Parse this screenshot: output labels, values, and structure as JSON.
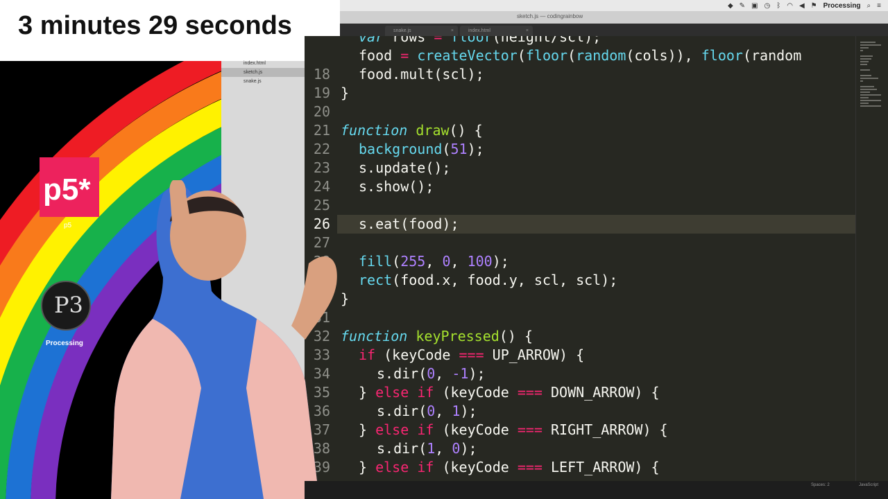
{
  "overlay": {
    "timer_text": "3 minutes 29 seconds"
  },
  "desktop": {
    "p5_logo_text": "p5*",
    "p5_label": "p5",
    "processing_logo_text": "P3",
    "processing_label": "Processing",
    "rainbow_colors": [
      "#ee1c24",
      "#f97a1b",
      "#fff200",
      "#17b14b",
      "#1d72d4",
      "#7a2fbf"
    ]
  },
  "menubar": {
    "app_name": "Processing",
    "icons": [
      "dropbox-icon",
      "evernote-icon",
      "screen-icon",
      "time-machine-icon",
      "bluetooth-icon",
      "wifi-icon",
      "volume-icon",
      "flag-icon"
    ]
  },
  "window": {
    "title": "sketch.js — codingrainbow"
  },
  "sidebar": {
    "files": [
      {
        "name": "index.html",
        "active": false
      },
      {
        "name": "sketch.js",
        "active": true
      },
      {
        "name": "snake.js",
        "active": false
      }
    ]
  },
  "tabs": [
    {
      "label": "snake.js"
    },
    {
      "label": "index.html"
    }
  ],
  "editor": {
    "active_line": "26",
    "lines": [
      {
        "n": "",
        "code": "var rows = floor(height/scl);"
      },
      {
        "n": "",
        "code": "food = createVector(floor(random(cols)), floor(random"
      },
      {
        "n": "18",
        "code": "food.mult(scl);"
      },
      {
        "n": "19",
        "code": "}"
      },
      {
        "n": "20",
        "code": ""
      },
      {
        "n": "21",
        "code": "function draw() {"
      },
      {
        "n": "22",
        "code": "background(51);"
      },
      {
        "n": "23",
        "code": "s.update();"
      },
      {
        "n": "24",
        "code": "s.show();"
      },
      {
        "n": "25",
        "code": ""
      },
      {
        "n": "26",
        "code": "s.eat(food);"
      },
      {
        "n": "27",
        "code": ""
      },
      {
        "n": "28",
        "code": "fill(255, 0, 100);"
      },
      {
        "n": "29",
        "code": "rect(food.x, food.y, scl, scl);"
      },
      {
        "n": "30",
        "code": "}"
      },
      {
        "n": "31",
        "code": ""
      },
      {
        "n": "32",
        "code": "function keyPressed() {"
      },
      {
        "n": "33",
        "code": "if (keyCode === UP_ARROW) {"
      },
      {
        "n": "34",
        "code": "s.dir(0, -1);"
      },
      {
        "n": "35",
        "code": "} else if (keyCode === DOWN_ARROW) {"
      },
      {
        "n": "36",
        "code": "s.dir(0, 1);"
      },
      {
        "n": "37",
        "code": "} else if (keyCode === RIGHT_ARROW) {"
      },
      {
        "n": "38",
        "code": "s.dir(1, 0);"
      },
      {
        "n": "39",
        "code": "} else if (keyCode === LEFT_ARROW) {"
      }
    ]
  },
  "statusbar": {
    "indent": "Spaces: 2",
    "syntax": "JavaScript"
  }
}
